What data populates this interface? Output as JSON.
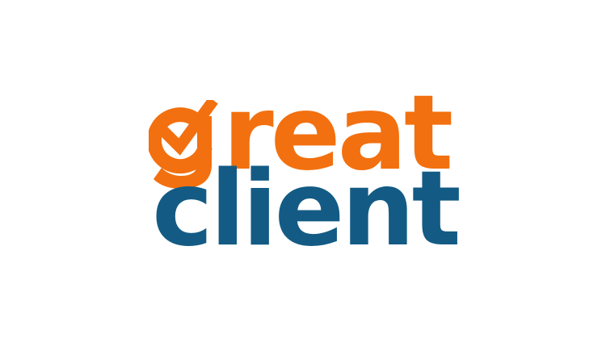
{
  "logo": {
    "word_top": "great",
    "word_top_rest": "reat",
    "word_bottom": "client",
    "colors": {
      "orange": "#f2700f",
      "blue": "#135b84",
      "background": "#ffffff"
    },
    "icon": "checkmark-g-icon"
  }
}
